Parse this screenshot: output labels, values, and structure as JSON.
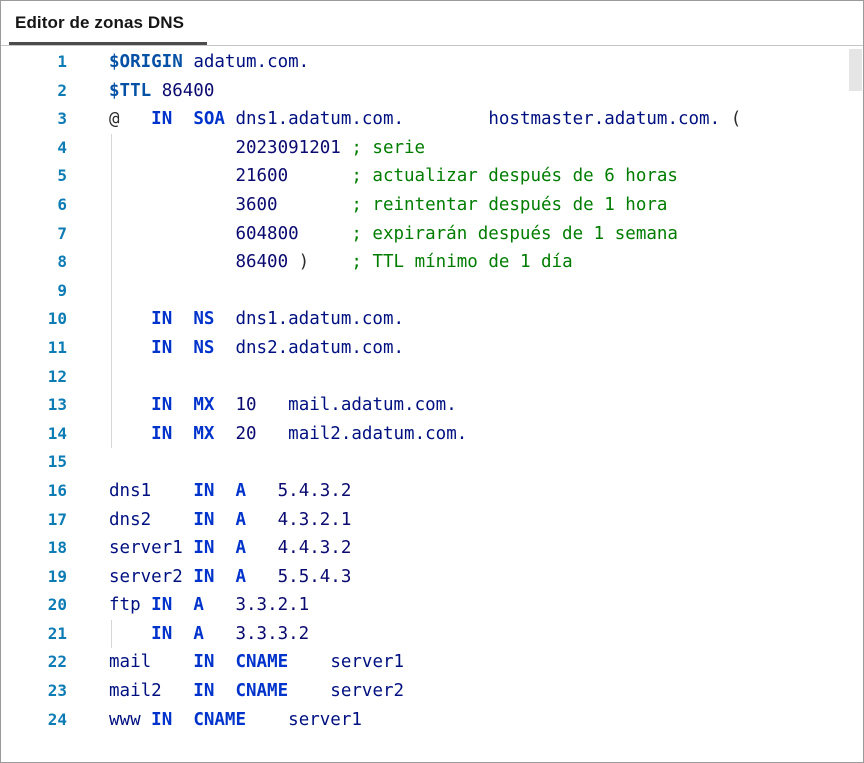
{
  "window": {
    "title": "Editor de zonas DNS"
  },
  "theme": {
    "title_color": "#161616",
    "tab_underline": "#4c4c4c",
    "header_border": "#c6c6c6",
    "outer_border": "#9b9b9b",
    "line_number": "#0d7cb5",
    "directive": "#0451a5",
    "keyword": "#0033cc",
    "domain": "#001080",
    "number": "#0a0a70",
    "comment": "#007d00",
    "punctuation": "#2b2b2b",
    "indent_guide": "#d6d6d6"
  },
  "editor": {
    "lines": [
      {
        "n": "1",
        "guide": false,
        "seg": [
          [
            "dir",
            "$ORIGIN"
          ],
          [
            "pln",
            " "
          ],
          [
            "dom",
            "adatum.com."
          ]
        ]
      },
      {
        "n": "2",
        "guide": false,
        "seg": [
          [
            "dir",
            "$TTL"
          ],
          [
            "pln",
            " "
          ],
          [
            "num",
            "86400"
          ]
        ]
      },
      {
        "n": "3",
        "guide": false,
        "seg": [
          [
            "pun",
            "@"
          ],
          [
            "pln",
            "   "
          ],
          [
            "kw",
            "IN"
          ],
          [
            "pln",
            "  "
          ],
          [
            "kw",
            "SOA"
          ],
          [
            "pln",
            " "
          ],
          [
            "dom",
            "dns1.adatum.com."
          ],
          [
            "pln",
            "        "
          ],
          [
            "dom",
            "hostmaster.adatum.com."
          ],
          [
            "pln",
            " "
          ],
          [
            "pun",
            "("
          ]
        ]
      },
      {
        "n": "4",
        "guide": true,
        "seg": [
          [
            "pln",
            "            "
          ],
          [
            "num",
            "2023091201"
          ],
          [
            "pln",
            " "
          ],
          [
            "com",
            "; serie"
          ]
        ]
      },
      {
        "n": "5",
        "guide": true,
        "seg": [
          [
            "pln",
            "            "
          ],
          [
            "num",
            "21600"
          ],
          [
            "pln",
            "      "
          ],
          [
            "com",
            "; actualizar después de 6 horas"
          ]
        ]
      },
      {
        "n": "6",
        "guide": true,
        "seg": [
          [
            "pln",
            "            "
          ],
          [
            "num",
            "3600"
          ],
          [
            "pln",
            "       "
          ],
          [
            "com",
            "; reintentar después de 1 hora"
          ]
        ]
      },
      {
        "n": "7",
        "guide": true,
        "seg": [
          [
            "pln",
            "            "
          ],
          [
            "num",
            "604800"
          ],
          [
            "pln",
            "     "
          ],
          [
            "com",
            "; expirarán después de 1 semana"
          ]
        ]
      },
      {
        "n": "8",
        "guide": true,
        "seg": [
          [
            "pln",
            "            "
          ],
          [
            "num",
            "86400"
          ],
          [
            "pln",
            " "
          ],
          [
            "pun",
            ")"
          ],
          [
            "pln",
            "    "
          ],
          [
            "com",
            "; TTL mínimo de 1 día"
          ]
        ]
      },
      {
        "n": "9",
        "guide": true,
        "seg": []
      },
      {
        "n": "10",
        "guide": true,
        "seg": [
          [
            "pln",
            "    "
          ],
          [
            "kw",
            "IN"
          ],
          [
            "pln",
            "  "
          ],
          [
            "kw",
            "NS"
          ],
          [
            "pln",
            "  "
          ],
          [
            "dom",
            "dns1.adatum.com."
          ]
        ]
      },
      {
        "n": "11",
        "guide": true,
        "seg": [
          [
            "pln",
            "    "
          ],
          [
            "kw",
            "IN"
          ],
          [
            "pln",
            "  "
          ],
          [
            "kw",
            "NS"
          ],
          [
            "pln",
            "  "
          ],
          [
            "dom",
            "dns2.adatum.com."
          ]
        ]
      },
      {
        "n": "12",
        "guide": true,
        "seg": []
      },
      {
        "n": "13",
        "guide": true,
        "seg": [
          [
            "pln",
            "    "
          ],
          [
            "kw",
            "IN"
          ],
          [
            "pln",
            "  "
          ],
          [
            "kw",
            "MX"
          ],
          [
            "pln",
            "  "
          ],
          [
            "num",
            "10"
          ],
          [
            "pln",
            "   "
          ],
          [
            "dom",
            "mail.adatum.com."
          ]
        ]
      },
      {
        "n": "14",
        "guide": true,
        "seg": [
          [
            "pln",
            "    "
          ],
          [
            "kw",
            "IN"
          ],
          [
            "pln",
            "  "
          ],
          [
            "kw",
            "MX"
          ],
          [
            "pln",
            "  "
          ],
          [
            "num",
            "20"
          ],
          [
            "pln",
            "   "
          ],
          [
            "dom",
            "mail2.adatum.com."
          ]
        ]
      },
      {
        "n": "15",
        "guide": false,
        "seg": []
      },
      {
        "n": "16",
        "guide": false,
        "seg": [
          [
            "dom",
            "dns1"
          ],
          [
            "pln",
            "    "
          ],
          [
            "kw",
            "IN"
          ],
          [
            "pln",
            "  "
          ],
          [
            "kw",
            "A"
          ],
          [
            "pln",
            "   "
          ],
          [
            "num",
            "5.4.3.2"
          ]
        ]
      },
      {
        "n": "17",
        "guide": false,
        "seg": [
          [
            "dom",
            "dns2"
          ],
          [
            "pln",
            "    "
          ],
          [
            "kw",
            "IN"
          ],
          [
            "pln",
            "  "
          ],
          [
            "kw",
            "A"
          ],
          [
            "pln",
            "   "
          ],
          [
            "num",
            "4.3.2.1"
          ]
        ]
      },
      {
        "n": "18",
        "guide": false,
        "seg": [
          [
            "dom",
            "server1"
          ],
          [
            "pln",
            " "
          ],
          [
            "kw",
            "IN"
          ],
          [
            "pln",
            "  "
          ],
          [
            "kw",
            "A"
          ],
          [
            "pln",
            "   "
          ],
          [
            "num",
            "4.4.3.2"
          ]
        ]
      },
      {
        "n": "19",
        "guide": false,
        "seg": [
          [
            "dom",
            "server2"
          ],
          [
            "pln",
            " "
          ],
          [
            "kw",
            "IN"
          ],
          [
            "pln",
            "  "
          ],
          [
            "kw",
            "A"
          ],
          [
            "pln",
            "   "
          ],
          [
            "num",
            "5.5.4.3"
          ]
        ]
      },
      {
        "n": "20",
        "guide": false,
        "seg": [
          [
            "dom",
            "ftp"
          ],
          [
            "pln",
            " "
          ],
          [
            "kw",
            "IN"
          ],
          [
            "pln",
            "  "
          ],
          [
            "kw",
            "A"
          ],
          [
            "pln",
            "   "
          ],
          [
            "num",
            "3.3.2.1"
          ]
        ]
      },
      {
        "n": "21",
        "guide": true,
        "seg": [
          [
            "pln",
            "    "
          ],
          [
            "kw",
            "IN"
          ],
          [
            "pln",
            "  "
          ],
          [
            "kw",
            "A"
          ],
          [
            "pln",
            "   "
          ],
          [
            "num",
            "3.3.3.2"
          ]
        ]
      },
      {
        "n": "22",
        "guide": false,
        "seg": [
          [
            "dom",
            "mail"
          ],
          [
            "pln",
            "    "
          ],
          [
            "kw",
            "IN"
          ],
          [
            "pln",
            "  "
          ],
          [
            "kw",
            "CNAME"
          ],
          [
            "pln",
            "    "
          ],
          [
            "dom",
            "server1"
          ]
        ]
      },
      {
        "n": "23",
        "guide": false,
        "seg": [
          [
            "dom",
            "mail2"
          ],
          [
            "pln",
            "   "
          ],
          [
            "kw",
            "IN"
          ],
          [
            "pln",
            "  "
          ],
          [
            "kw",
            "CNAME"
          ],
          [
            "pln",
            "    "
          ],
          [
            "dom",
            "server2"
          ]
        ]
      },
      {
        "n": "24",
        "guide": false,
        "seg": [
          [
            "dom",
            "www"
          ],
          [
            "pln",
            " "
          ],
          [
            "kw",
            "IN"
          ],
          [
            "pln",
            "  "
          ],
          [
            "kw",
            "CNAME"
          ],
          [
            "pln",
            "    "
          ],
          [
            "dom",
            "server1"
          ]
        ]
      }
    ]
  }
}
